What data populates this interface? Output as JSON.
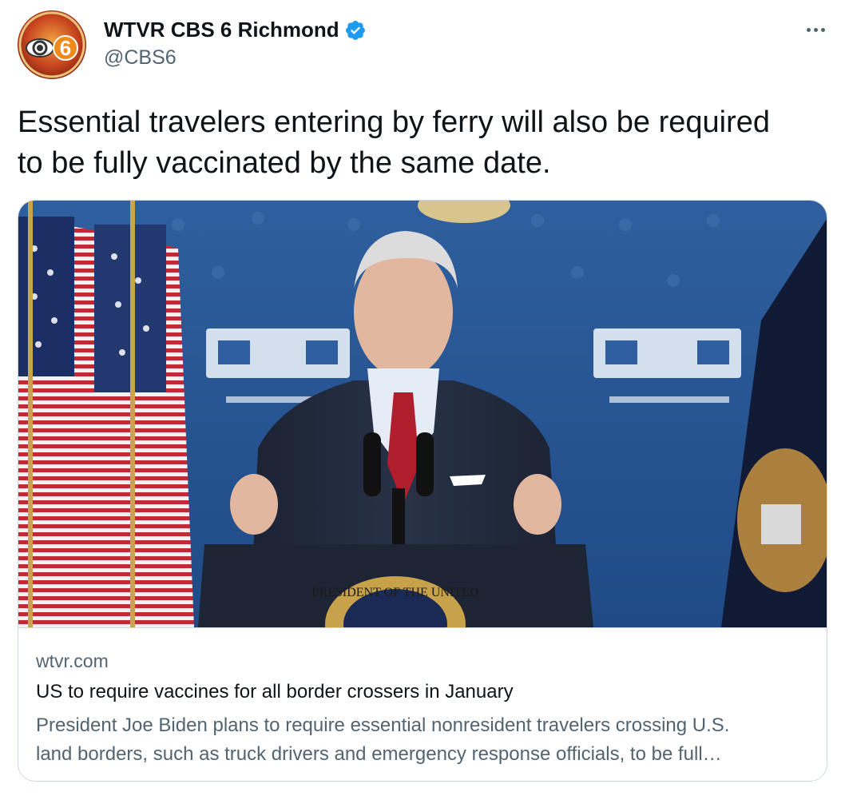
{
  "account": {
    "display_name": "WTVR CBS 6 Richmond",
    "handle": "@CBS6",
    "verified": true,
    "avatar_icon": "cbs6-logo-icon",
    "avatar_text": "6"
  },
  "tweet": {
    "text": "Essential travelers entering by ferry will also be required to be fully vaccinated by the same date."
  },
  "card": {
    "domain": "wtvr.com",
    "title": "US to require vaccines for all border crossers in January",
    "description_line_1": "President Joe Biden plans to require essential nonresident travelers crossing U.S.",
    "description_line_2": "land borders, such as truck drivers and emergency response officials, to be full…",
    "image_seal_text": "PRESIDENT OF THE UNITED"
  },
  "icons": {
    "verified": "verified-badge-icon",
    "more": "more-options-icon"
  },
  "colors": {
    "verified_blue": "#1d9bf0",
    "secondary_text": "#536471",
    "border": "#cfd9de"
  }
}
